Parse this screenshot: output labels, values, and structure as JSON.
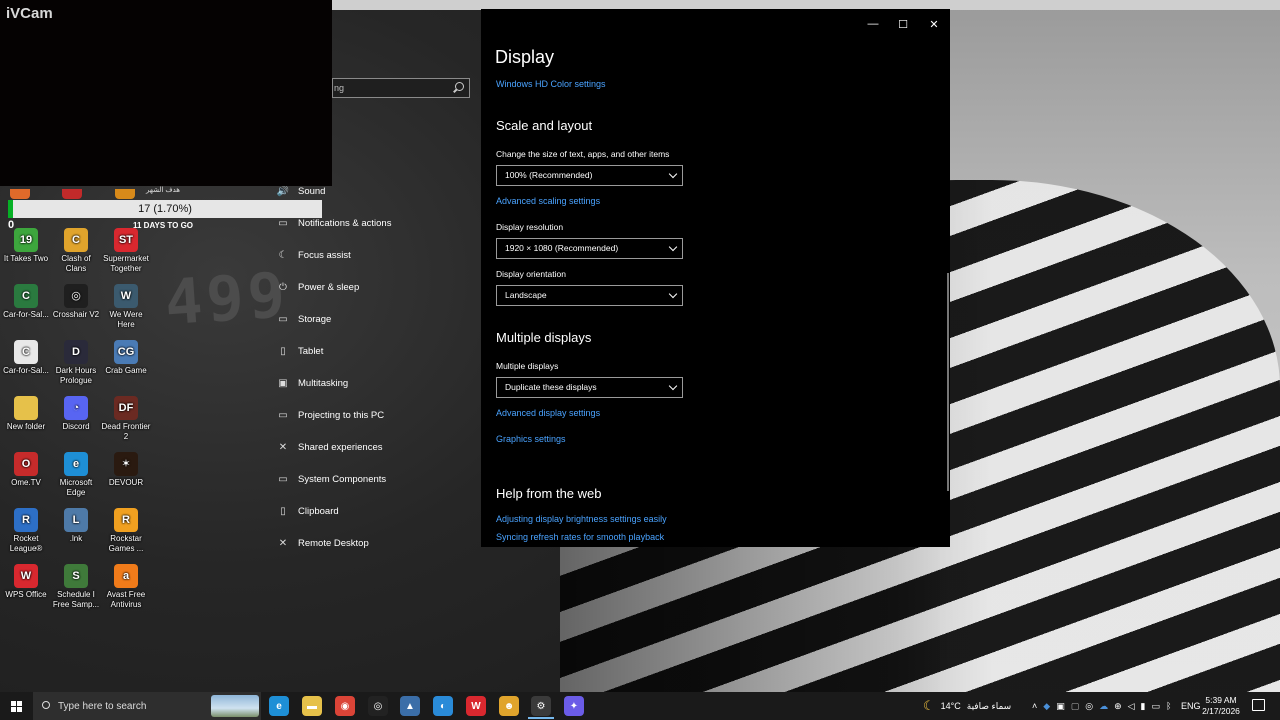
{
  "ivcam": {
    "title": "iVCam"
  },
  "wallpaper": {
    "painted_number": "499"
  },
  "countdown": {
    "progress_text": "17 (1.70%)",
    "progress_value": 0.017,
    "days_to_go": "11 DAYS TO GO",
    "zero": "0",
    "partial_text": "هدف الشهر"
  },
  "desktop_icons": [
    {
      "label": "It Takes Two",
      "color": "#3da63d",
      "glyph": "19"
    },
    {
      "label": "Clash of Clans",
      "color": "#e0a42c",
      "glyph": "C"
    },
    {
      "label": "Supermarket Together",
      "color": "#d9282f",
      "glyph": "ST"
    },
    {
      "label": "Car-for-Sal...",
      "color": "#2a7a3f",
      "glyph": "C"
    },
    {
      "label": "Crosshair V2",
      "color": "#1f1f1f",
      "glyph": "◎"
    },
    {
      "label": "We Were Here",
      "color": "#3b5a6e",
      "glyph": "W"
    },
    {
      "label": "Car-for-Sal...",
      "color": "#e8e8e8",
      "glyph": "C"
    },
    {
      "label": "Dark Hours Prologue",
      "color": "#2a2a3a",
      "glyph": "D"
    },
    {
      "label": "Crab Game",
      "color": "#4a7bb5",
      "glyph": "CG"
    },
    {
      "label": "New folder",
      "color": "#e6c14a",
      "glyph": ""
    },
    {
      "label": "Discord",
      "color": "#5865f2",
      "glyph": "◔"
    },
    {
      "label": "Dead Frontier 2",
      "color": "#6b2a22",
      "glyph": "DF"
    },
    {
      "label": "Ome.TV",
      "color": "#c72b2b",
      "glyph": "O"
    },
    {
      "label": "Microsoft Edge",
      "color": "#1e8fd6",
      "glyph": "e"
    },
    {
      "label": "DEVOUR",
      "color": "#2a1a10",
      "glyph": "✶"
    },
    {
      "label": "Rocket League®",
      "color": "#2d6fc6",
      "glyph": "R"
    },
    {
      "label": ".lnk",
      "color": "#4e7aa8",
      "glyph": "L"
    },
    {
      "label": "Rockstar Games ...",
      "color": "#f0a020",
      "glyph": "R"
    },
    {
      "label": "WPS Office",
      "color": "#d9282f",
      "glyph": "W"
    },
    {
      "label": "Schedule I Free Samp...",
      "color": "#3f7a3a",
      "glyph": "S"
    },
    {
      "label": "Avast Free Antivirus",
      "color": "#f07b1a",
      "glyph": "a"
    }
  ],
  "settings_nav": {
    "search_value": "ng",
    "items": [
      {
        "label": "Sound",
        "icon": "speaker-icon",
        "glyph": "🔊"
      },
      {
        "label": "Notifications & actions",
        "icon": "notification-icon",
        "glyph": "▭"
      },
      {
        "label": "Focus assist",
        "icon": "moon-icon",
        "glyph": "☾"
      },
      {
        "label": "Power & sleep",
        "icon": "power-icon",
        "glyph": "⏻"
      },
      {
        "label": "Storage",
        "icon": "storage-icon",
        "glyph": "▭"
      },
      {
        "label": "Tablet",
        "icon": "tablet-icon",
        "glyph": "▯"
      },
      {
        "label": "Multitasking",
        "icon": "multitasking-icon",
        "glyph": "▣"
      },
      {
        "label": "Projecting to this PC",
        "icon": "projector-icon",
        "glyph": "▭"
      },
      {
        "label": "Shared experiences",
        "icon": "shared-icon",
        "glyph": "✕"
      },
      {
        "label": "System Components",
        "icon": "components-icon",
        "glyph": "▭"
      },
      {
        "label": "Clipboard",
        "icon": "clipboard-icon",
        "glyph": "▯"
      },
      {
        "label": "Remote Desktop",
        "icon": "remote-desktop-icon",
        "glyph": "✕"
      }
    ]
  },
  "window": {
    "title": "Display",
    "controls": {
      "minimize": "—",
      "maximize": "☐",
      "close": "✕"
    },
    "hd_color_link": "Windows HD Color settings",
    "scale_section": {
      "title": "Scale and layout",
      "scale_label": "Change the size of text, apps, and other items",
      "scale_value": "100% (Recommended)",
      "advanced_scaling_link": "Advanced scaling settings",
      "resolution_label": "Display resolution",
      "resolution_value": "1920 × 1080 (Recommended)",
      "orientation_label": "Display orientation",
      "orientation_value": "Landscape"
    },
    "multiple_section": {
      "title": "Multiple displays",
      "label": "Multiple displays",
      "value": "Duplicate these displays",
      "advanced_display_link": "Advanced display settings",
      "graphics_link": "Graphics settings"
    },
    "help_section": {
      "title": "Help from the web",
      "links": [
        "Adjusting display brightness settings easily",
        "Syncing refresh rates for smooth playback"
      ]
    }
  },
  "taskbar": {
    "search_placeholder": "Type here to search",
    "apps": [
      {
        "name": "edge",
        "color": "#1e8fd6",
        "glyph": "e"
      },
      {
        "name": "file-explorer",
        "color": "#e6c14a",
        "glyph": "▬"
      },
      {
        "name": "chrome",
        "color": "#db4437",
        "glyph": "◉"
      },
      {
        "name": "crosshair",
        "color": "#222",
        "glyph": "◎"
      },
      {
        "name": "photos",
        "color": "#3b6ea8",
        "glyph": "▲"
      },
      {
        "name": "ivcam",
        "color": "#2a8bd8",
        "glyph": "◐"
      },
      {
        "name": "wps",
        "color": "#d9282f",
        "glyph": "W"
      },
      {
        "name": "game",
        "color": "#e0a42c",
        "glyph": "☻"
      },
      {
        "name": "settings",
        "color": "#3a3a3a",
        "glyph": "⚙"
      },
      {
        "name": "copilot",
        "color": "#6b5ce7",
        "glyph": "✦"
      }
    ],
    "weather_temp": "14°C",
    "weather_text": "سماء صافية",
    "language": "ENG",
    "time": "5:39 AM",
    "date": "2/17/2026"
  }
}
